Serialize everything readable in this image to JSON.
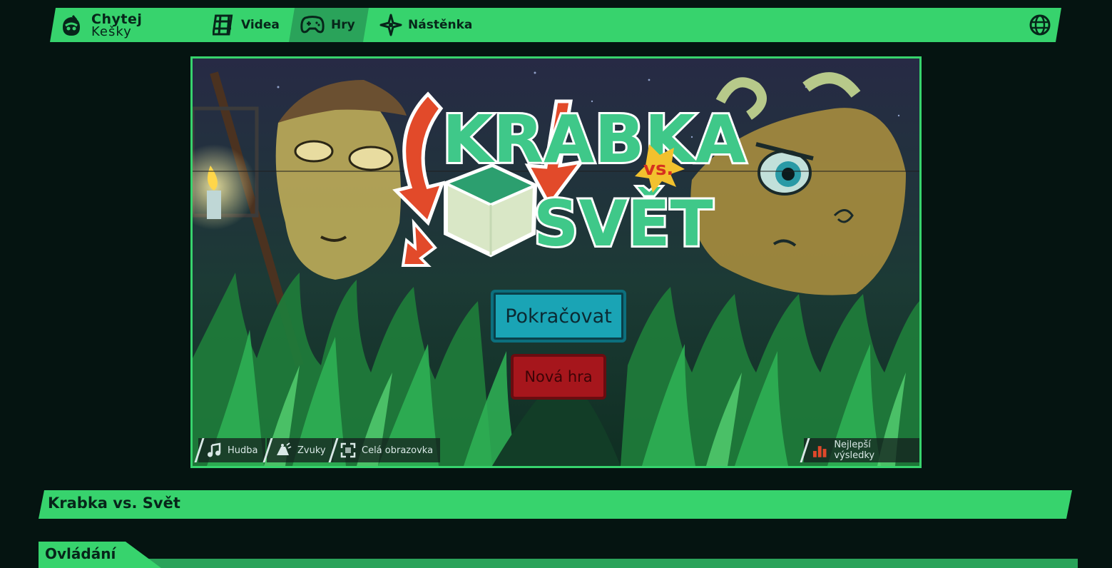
{
  "nav": {
    "brand_line1": "Chytej",
    "brand_line2": "Kešky",
    "items": [
      {
        "label": "Videa",
        "icon": "film-icon"
      },
      {
        "label": "Hry",
        "icon": "gamepad-icon",
        "active": true
      },
      {
        "label": "Nástěnka",
        "icon": "board-icon"
      }
    ],
    "language_icon": "globe-icon"
  },
  "game": {
    "logo_line1": "KRABKA",
    "logo_vs": "vs.",
    "logo_line2": "SVĚT",
    "continue_label": "Pokračovat",
    "new_game_label": "Nová hra",
    "controls": [
      {
        "label": "Hudba",
        "icon": "music-icon"
      },
      {
        "label": "Zvuky",
        "icon": "sound-icon"
      },
      {
        "label": "Celá obrazovka",
        "icon": "fullscreen-icon"
      }
    ],
    "highscores_label": "Nejlepší výsledky",
    "highscores_icon": "bar-chart-icon"
  },
  "page": {
    "title": "Krabka vs. Svět",
    "section_title": "Ovládání"
  },
  "colors": {
    "background": "#051411",
    "accent": "#37d36d",
    "accent_dark": "#2aa35a",
    "continue_button": "#1aa4b5",
    "new_game_button": "#a6161c"
  }
}
